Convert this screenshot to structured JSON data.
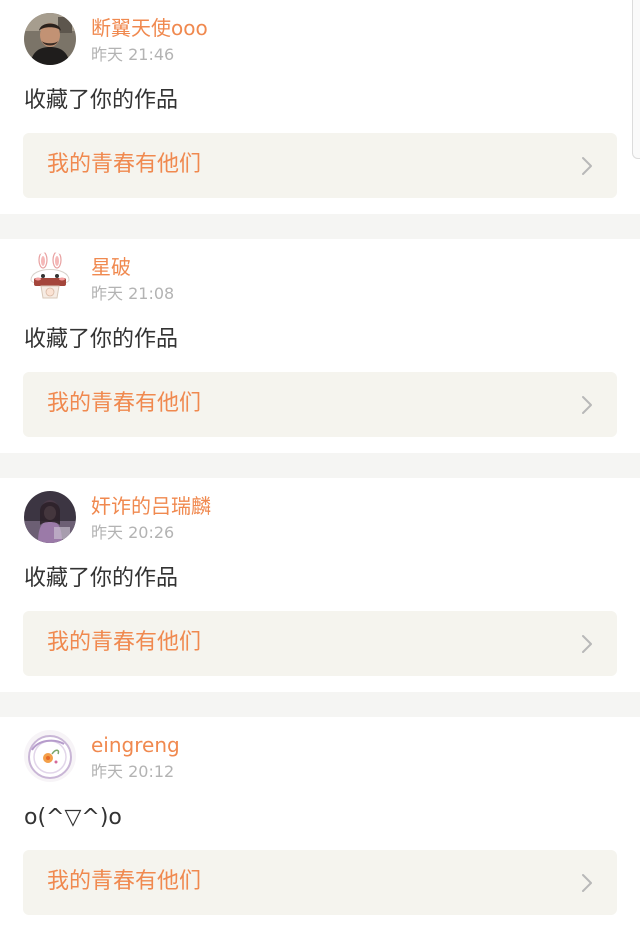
{
  "notifications": [
    {
      "username": "断翼天使ooo",
      "time": "昨天 21:46",
      "message": "收藏了你的作品",
      "work_title": "我的青春有他们",
      "avatar_icon": "man-photo-avatar"
    },
    {
      "username": "星破",
      "time": "昨天 21:08",
      "message": "收藏了你的作品",
      "work_title": "我的青春有他们",
      "avatar_icon": "bunny-cartoon-avatar"
    },
    {
      "username": "奸诈的吕瑞麟",
      "time": "昨天 20:26",
      "message": "收藏了你的作品",
      "work_title": "我的青春有他们",
      "avatar_icon": "girl-photo-avatar"
    },
    {
      "username": "eingreng",
      "time": "昨天 20:12",
      "message": "o(^▽^)o",
      "work_title": "我的青春有他们",
      "avatar_icon": "flower-plate-avatar"
    }
  ],
  "colors": {
    "accent": "#f0894f",
    "time_gray": "#b3b3b3",
    "text": "#333333",
    "link_bg": "#f5f4ee",
    "separator": "#f5f5f3"
  }
}
